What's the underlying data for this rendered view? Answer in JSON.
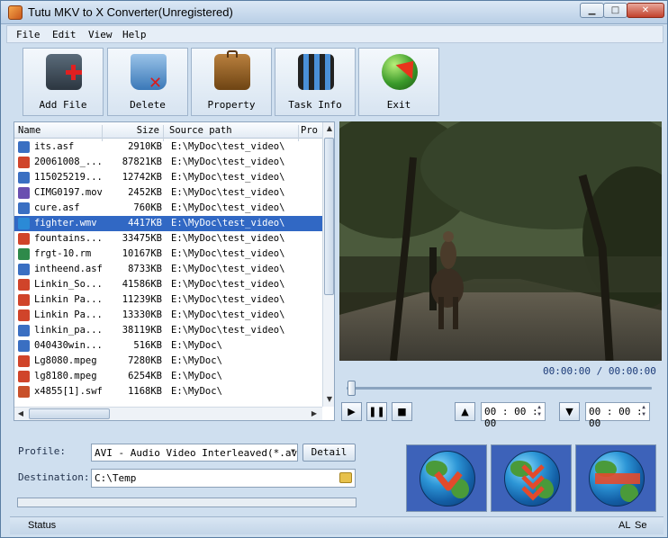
{
  "window": {
    "title": "Tutu MKV to X Converter(Unregistered)"
  },
  "menu": [
    "File",
    "Edit",
    "View",
    "Help"
  ],
  "toolbar": [
    {
      "label": "Add File",
      "icon": "add-file-icon"
    },
    {
      "label": "Delete",
      "icon": "recycle-bin-icon"
    },
    {
      "label": "Property",
      "icon": "briefcase-icon"
    },
    {
      "label": "Task Info",
      "icon": "film-icon"
    },
    {
      "label": "Exit",
      "icon": "exit-globe-icon"
    }
  ],
  "file_list": {
    "columns": [
      "Name",
      "Size",
      "Source path",
      "Pro"
    ],
    "rows": [
      {
        "name": "its.asf",
        "size": "2910KB",
        "path": "E:\\MyDoc\\test_video\\",
        "icon": "asf-icon"
      },
      {
        "name": "20061008_...",
        "size": "87821KB",
        "path": "E:\\MyDoc\\test_video\\",
        "icon": "mpeg-icon"
      },
      {
        "name": "115025219...",
        "size": "12742KB",
        "path": "E:\\MyDoc\\test_video\\",
        "icon": "asf-icon"
      },
      {
        "name": "CIMG0197.mov",
        "size": "2452KB",
        "path": "E:\\MyDoc\\test_video\\",
        "icon": "mov-icon"
      },
      {
        "name": "cure.asf",
        "size": "760KB",
        "path": "E:\\MyDoc\\test_video\\",
        "icon": "asf-icon"
      },
      {
        "name": "fighter.wmv",
        "size": "4417KB",
        "path": "E:\\MyDoc\\test_video\\",
        "icon": "wmv-icon",
        "selected": true
      },
      {
        "name": "fountains...",
        "size": "33475KB",
        "path": "E:\\MyDoc\\test_video\\",
        "icon": "mpeg-icon"
      },
      {
        "name": "frgt-10.rm",
        "size": "10167KB",
        "path": "E:\\MyDoc\\test_video\\",
        "icon": "rm-icon"
      },
      {
        "name": "intheend.asf",
        "size": "8733KB",
        "path": "E:\\MyDoc\\test_video\\",
        "icon": "asf-icon"
      },
      {
        "name": "Linkin_So...",
        "size": "41586KB",
        "path": "E:\\MyDoc\\test_video\\",
        "icon": "mpeg-icon"
      },
      {
        "name": "Linkin Pa...",
        "size": "11239KB",
        "path": "E:\\MyDoc\\test_video\\",
        "icon": "mpeg-icon"
      },
      {
        "name": "Linkin Pa...",
        "size": "13330KB",
        "path": "E:\\MyDoc\\test_video\\",
        "icon": "mpeg-icon"
      },
      {
        "name": "linkin_pa...",
        "size": "38119KB",
        "path": "E:\\MyDoc\\test_video\\",
        "icon": "asf-icon"
      },
      {
        "name": "040430win...",
        "size": "516KB",
        "path": "E:\\MyDoc\\",
        "icon": "asf-icon"
      },
      {
        "name": "Lg8080.mpeg",
        "size": "7280KB",
        "path": "E:\\MyDoc\\",
        "icon": "mpeg-icon"
      },
      {
        "name": "lg8180.mpeg",
        "size": "6254KB",
        "path": "E:\\MyDoc\\",
        "icon": "mpeg-icon"
      },
      {
        "name": "x4855[1].swf",
        "size": "1168KB",
        "path": "E:\\MyDoc\\",
        "icon": "swf-icon"
      }
    ]
  },
  "player": {
    "time": "00:00:00 / 00:00:00",
    "progress": 0,
    "start_time": "00 : 00 : 00",
    "end_time": "00 : 00 : 00"
  },
  "settings": {
    "profile_label": "Profile:",
    "profile_value": "AVI - Audio Video Interleaved(*.av:",
    "detail_label": "Detail",
    "destination_label": "Destination:",
    "destination_value": "C:\\Temp",
    "progress": 0
  },
  "status": {
    "text": "Status",
    "right1": "AL",
    "right2": "Se"
  },
  "colors": {
    "selection": "#3168c4",
    "panel": "#cfdfef",
    "convert_bg": "#3d62b9"
  }
}
